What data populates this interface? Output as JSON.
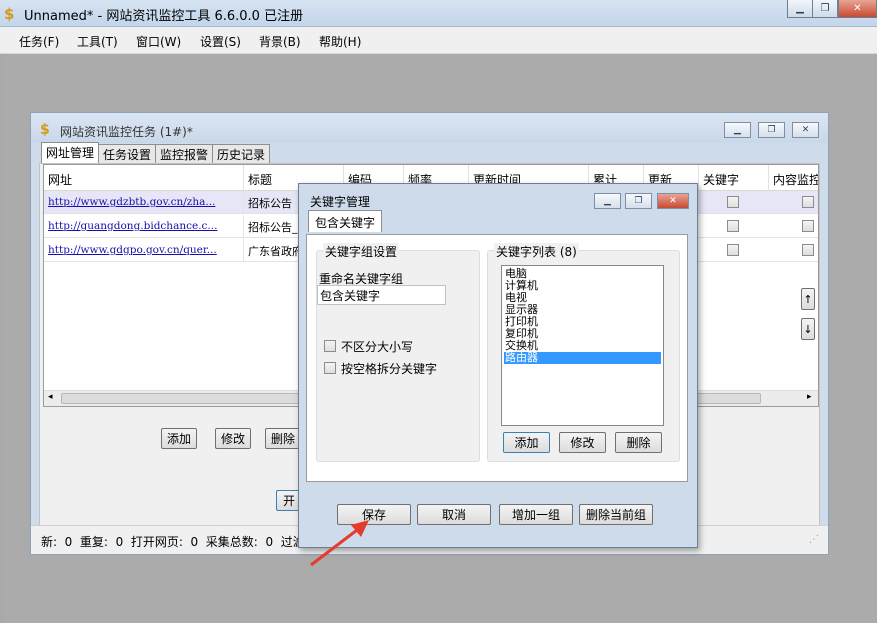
{
  "app": {
    "title": "Unnamed* - 网站资讯监控工具 6.6.0.0  已注册",
    "menu": [
      "任务(F)",
      "工具(T)",
      "窗口(W)",
      "设置(S)",
      "背景(B)",
      "帮助(H)"
    ]
  },
  "child": {
    "title": "网站资讯监控任务  (1#)*",
    "tabs": [
      "网址管理",
      "任务设置",
      "监控报警",
      "历史记录"
    ],
    "columns": [
      "网址",
      "标题",
      "编码",
      "频率",
      "更新时间",
      "累计",
      "更新",
      "关键字",
      "内容监控"
    ],
    "rows": [
      {
        "url": "http://www.gdzbtb.gov.cn/zha...",
        "title": "招标公告"
      },
      {
        "url": "http://guangdong.bidchance.c...",
        "title": "招标公告_"
      },
      {
        "url": "http://www.gdgpo.gov.cn/quer...",
        "title": "广东省政府"
      }
    ],
    "buttons": {
      "add": "添加",
      "edit": "修改",
      "delete": "删除",
      "start": "开"
    },
    "status": "新:  0  重复:  0  打开网页:  0  采集总数:  0  过滤"
  },
  "dialog": {
    "title": "关键字管理",
    "tab": "包含关键字",
    "group_settings_label": "关键字组设置",
    "rename_label": "重命名关键字组",
    "rename_value": "包含关键字",
    "case_insensitive_label": "不区分大小写",
    "split_space_label": "按空格拆分关键字",
    "list_label": "关键字列表 (8)",
    "keywords": [
      "电脑",
      "计算机",
      "电视",
      "显示器",
      "打印机",
      "复印机",
      "交换机",
      "路由器"
    ],
    "selected_keyword": "路由器",
    "list_buttons": {
      "add": "添加",
      "edit": "修改",
      "delete": "删除"
    },
    "footer_buttons": {
      "save": "保存",
      "cancel": "取消",
      "add_group": "增加一组",
      "delete_group": "删除当前组"
    }
  }
}
